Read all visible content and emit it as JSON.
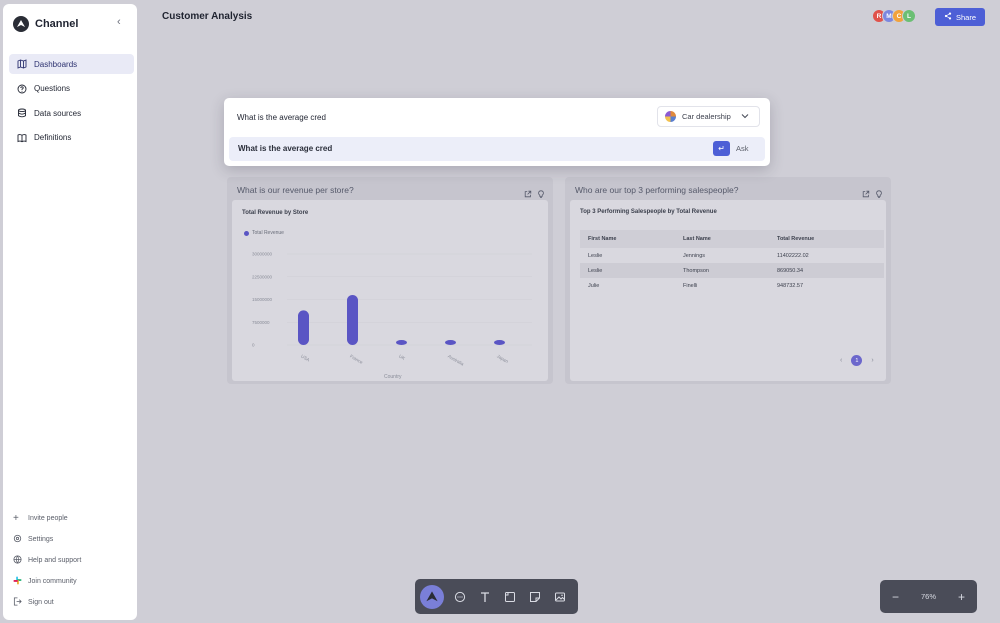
{
  "app": {
    "name": "Channel",
    "collapse_icon": "chevron-left-icon"
  },
  "sidebar": {
    "items": [
      {
        "label": "Dashboards",
        "icon": "map-icon",
        "active": true
      },
      {
        "label": "Questions",
        "icon": "help-circle-icon",
        "active": false
      },
      {
        "label": "Data sources",
        "icon": "database-icon",
        "active": false
      },
      {
        "label": "Definitions",
        "icon": "book-icon",
        "active": false
      }
    ],
    "bottom_items": [
      {
        "label": "Invite people",
        "icon": "plus-icon"
      },
      {
        "label": "Settings",
        "icon": "gear-icon"
      },
      {
        "label": "Help and support",
        "icon": "globe-icon"
      },
      {
        "label": "Join community",
        "icon": "slack-icon"
      },
      {
        "label": "Sign out",
        "icon": "sign-out-icon"
      }
    ]
  },
  "header": {
    "title": "Customer Analysis",
    "avatars": [
      {
        "initial": "R",
        "color": "#e0524b"
      },
      {
        "initial": "M",
        "color": "#7b87e0"
      },
      {
        "initial": "C",
        "color": "#f2a23c"
      },
      {
        "initial": "L",
        "color": "#6bbf74"
      }
    ],
    "share_label": "Share"
  },
  "search": {
    "query": "What is the average cred",
    "source_label": "Car dealership",
    "suggestion": "What is the average cred",
    "ask_label": "Ask",
    "enter_symbol": "↵"
  },
  "cards": [
    {
      "title": "What is our revenue per store?",
      "inner_title": "Total Revenue by Store",
      "chart_data": {
        "type": "bar",
        "title": "Total Revenue by Store",
        "xlabel": "Country",
        "ylabel": "",
        "categories": [
          "USA",
          "France",
          "UK",
          "Australia",
          "Japan"
        ],
        "series": [
          {
            "name": "Total Revenue",
            "values": [
              11402222,
              16500000,
              1400000,
              1600000,
              300000
            ]
          }
        ],
        "y_ticks": [
          "30000000",
          "22500000",
          "15000000",
          "7500000",
          "0"
        ],
        "ylim": [
          0,
          30000000
        ],
        "legend": "top-left",
        "color": "#5a55c4"
      }
    },
    {
      "title": "Who are our top 3 performing salespeople?",
      "inner_title": "Top 3 Performing Salespeople by Total Revenue",
      "table": {
        "columns": [
          "First Name",
          "Last Name",
          "Total Revenue"
        ],
        "rows": [
          [
            "Leslie",
            "Jennings",
            "11402222.02"
          ],
          [
            "Leslie",
            "Thompson",
            "869050.34"
          ],
          [
            "Julie",
            "Finelli",
            "948732.57"
          ]
        ]
      },
      "pagination": {
        "current": "1",
        "prev": "‹",
        "next": "›"
      }
    }
  ],
  "toolbar": {
    "tools": [
      "logo-icon",
      "comment-icon",
      "text-icon",
      "frame-icon",
      "sticky-note-icon",
      "image-icon"
    ]
  },
  "zoom": {
    "value": "76%",
    "minus": "−",
    "plus": "+"
  }
}
